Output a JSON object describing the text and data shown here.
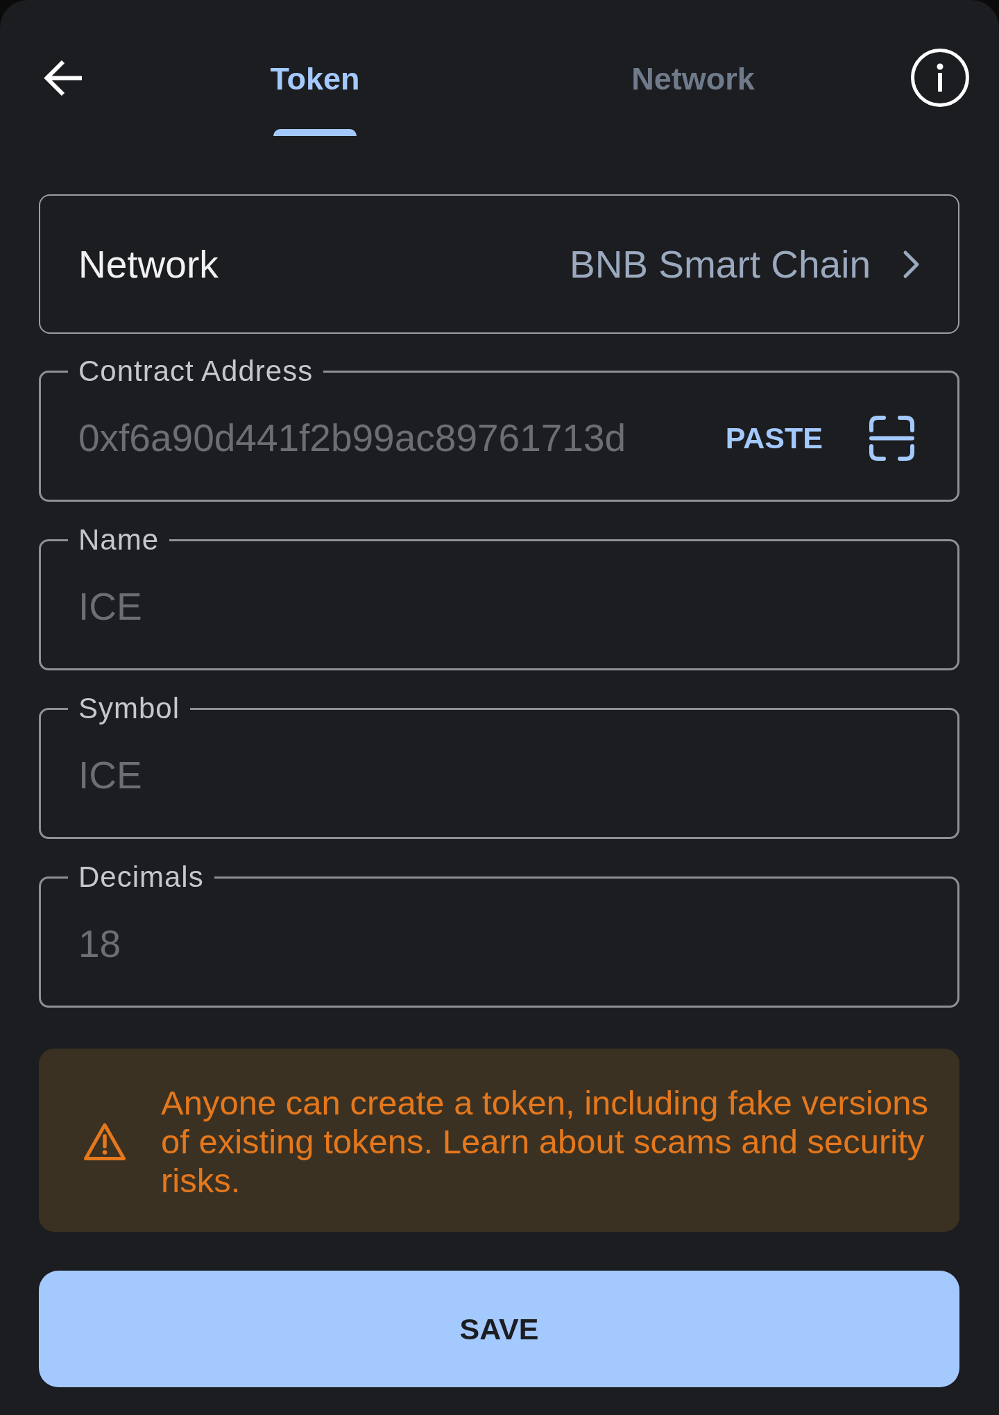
{
  "tabs": [
    {
      "label": "Token",
      "selected": true
    },
    {
      "label": "Network",
      "selected": false
    }
  ],
  "network_selector": {
    "label": "Network",
    "value": "BNB Smart Chain"
  },
  "fields": [
    {
      "kind": "address",
      "label": "Contract Address",
      "value": "0xf6a90d441f2b99ac89761713d",
      "disabled": true,
      "action": "PASTE"
    },
    {
      "kind": "text",
      "label": "Name",
      "value": "ICE",
      "disabled": true
    },
    {
      "kind": "text",
      "label": "Symbol",
      "value": "ICE",
      "disabled": true
    },
    {
      "kind": "number",
      "label": "Decimals",
      "value": "18",
      "disabled": true
    }
  ],
  "warning": {
    "text": "Anyone can create a token, including fake versions of existing tokens. Learn about scams and security risks."
  },
  "save_button": {
    "label": "SAVE"
  }
}
